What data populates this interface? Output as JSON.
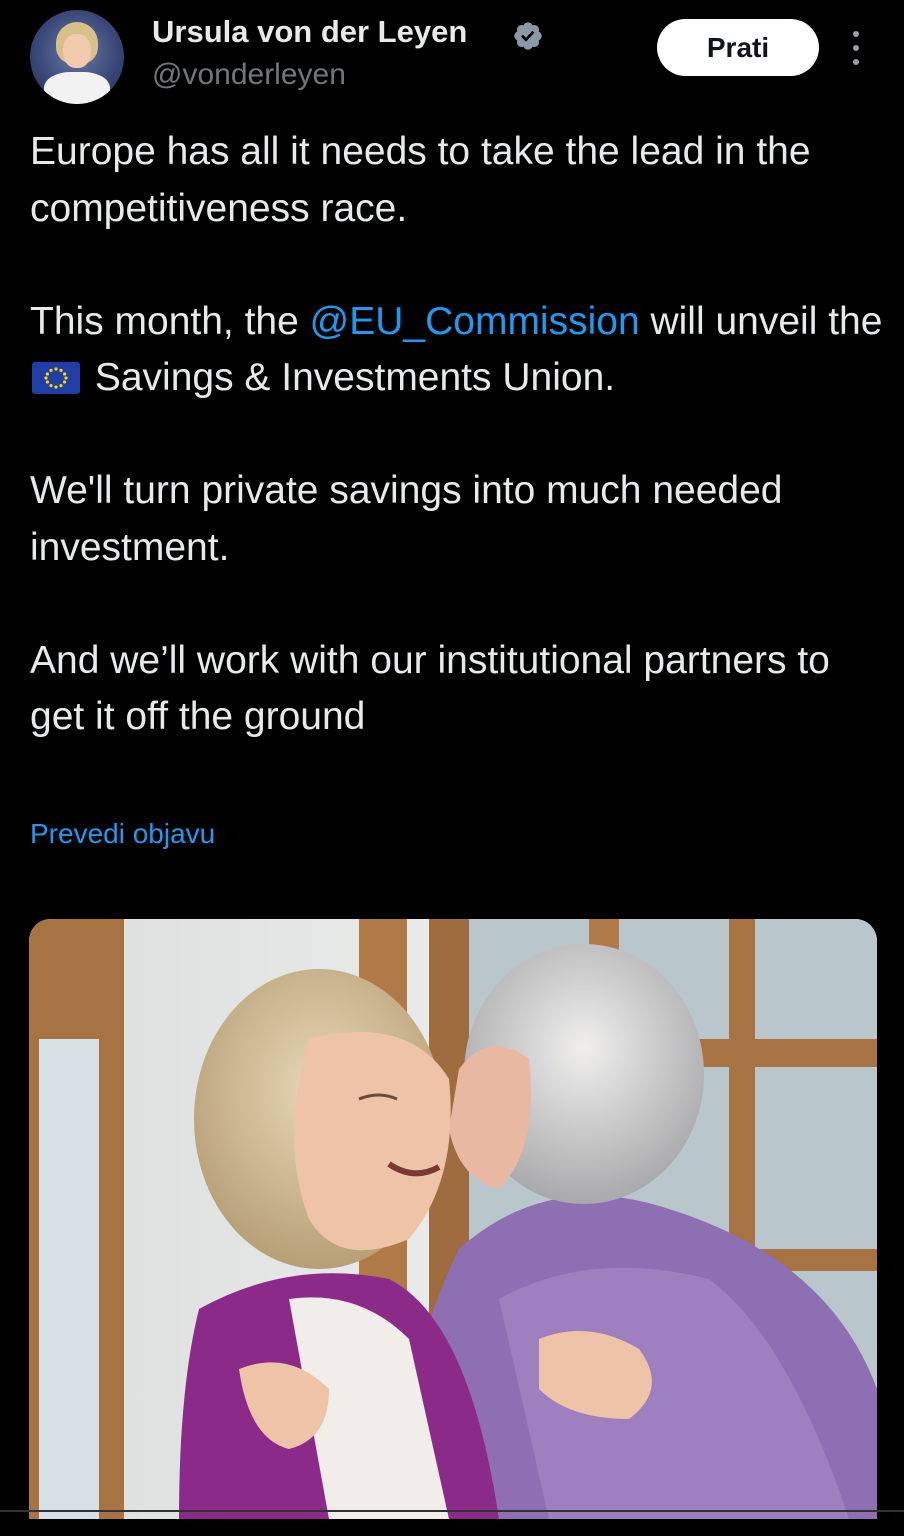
{
  "header": {
    "display_name": "Ursula von der Leyen",
    "handle": "@vonderleyen",
    "verified_icon": "verified-badge-icon",
    "follow_label": "Prati",
    "more_icon": "more-vertical-icon"
  },
  "tweet": {
    "para1": "Europe has all it needs to take the lead in the competitiveness race.",
    "para2_a": "This month, the ",
    "para2_mention": "@EU_Commission",
    "para2_b": " will unveil the ",
    "para2_flag": "eu-flag-emoji",
    "para2_c": " Savings & Investments Union.",
    "para3": "We'll turn private savings into much needed investment.",
    "para4": "And we’ll work with our institutional partners to get it off the ground"
  },
  "translate_label": "Prevedi objavu",
  "colors": {
    "background": "#000000",
    "text": "#e7e9ea",
    "secondary_text": "#71767b",
    "link": "#1d9bf0",
    "follow_button_bg": "#ffffff"
  }
}
